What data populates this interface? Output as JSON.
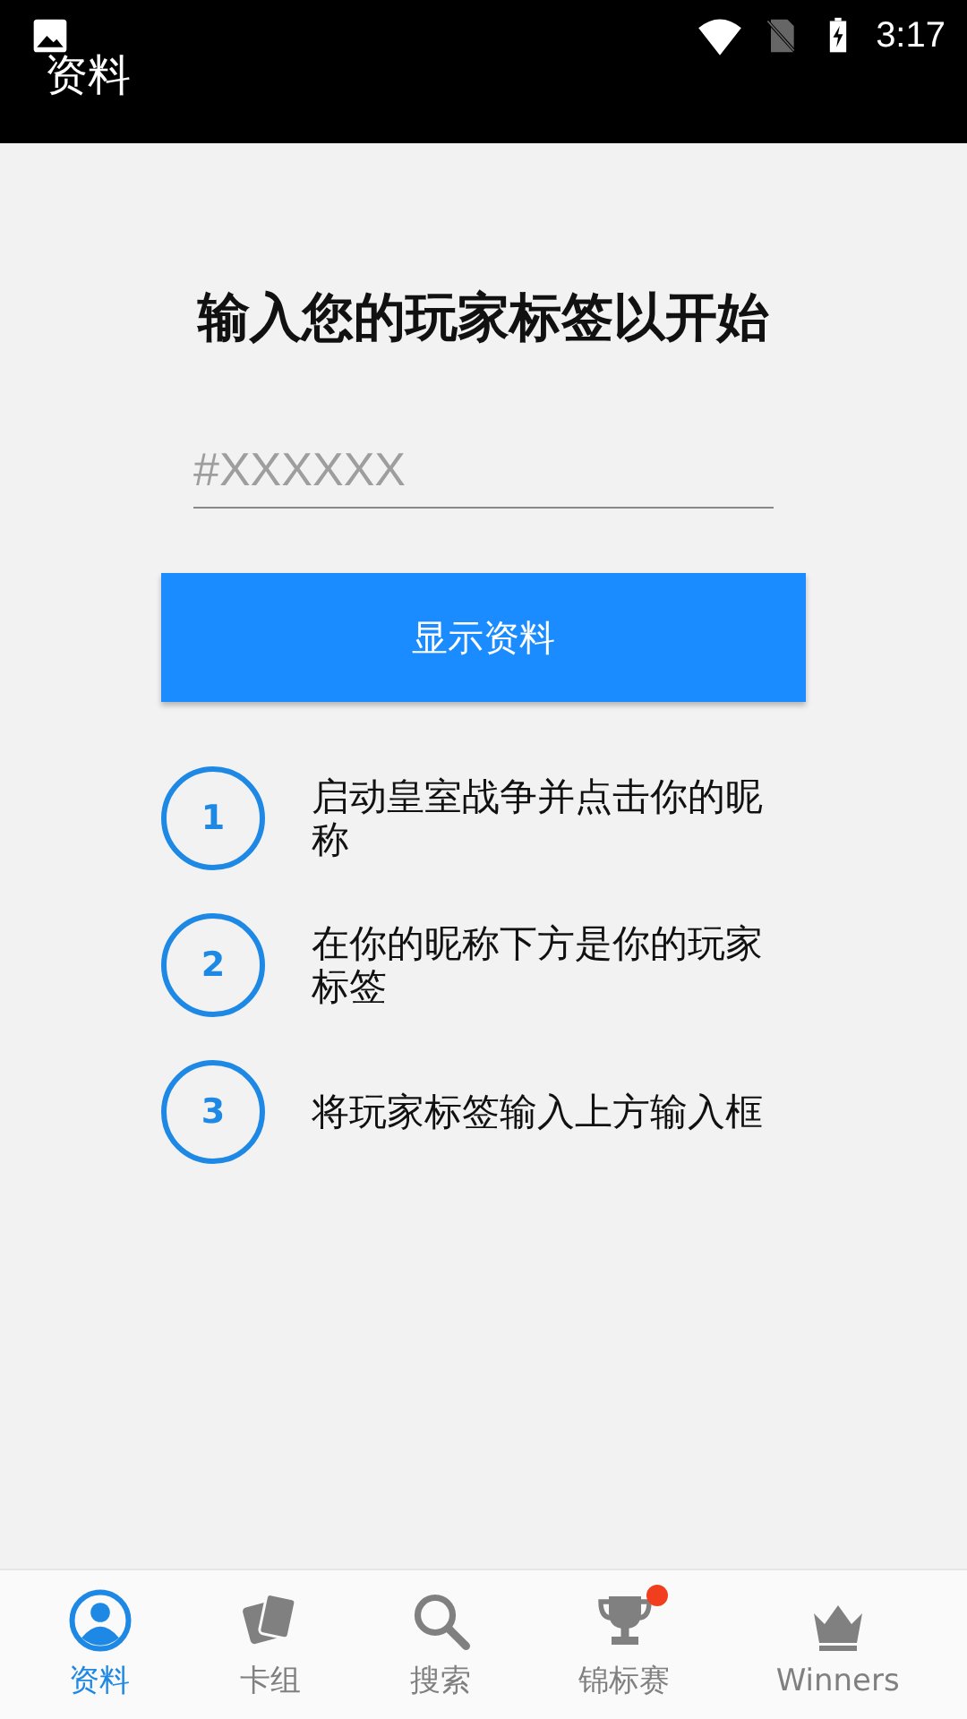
{
  "status_bar": {
    "time": "3:17"
  },
  "app_bar": {
    "title": "资料"
  },
  "heading": "输入您的玩家标签以开始",
  "tag_field": {
    "placeholder": "#XXXXXX"
  },
  "show_button": "显示资料",
  "steps": [
    {
      "number": "1",
      "text": "启动皇室战争并点击你的昵称"
    },
    {
      "number": "2",
      "text": "在你的昵称下方是你的玩家标签"
    },
    {
      "number": "3",
      "text": "将玩家标签输入上方输入框"
    }
  ],
  "tabs": [
    {
      "label": "资料",
      "kind": "profile",
      "selected": true,
      "badge": false
    },
    {
      "label": "卡组",
      "kind": "cards",
      "selected": false,
      "badge": false
    },
    {
      "label": "搜索",
      "kind": "search",
      "selected": false,
      "badge": false
    },
    {
      "label": "锦标赛",
      "kind": "trophy",
      "selected": false,
      "badge": true
    },
    {
      "label": "Winners",
      "kind": "crown",
      "selected": false,
      "badge": false
    }
  ]
}
